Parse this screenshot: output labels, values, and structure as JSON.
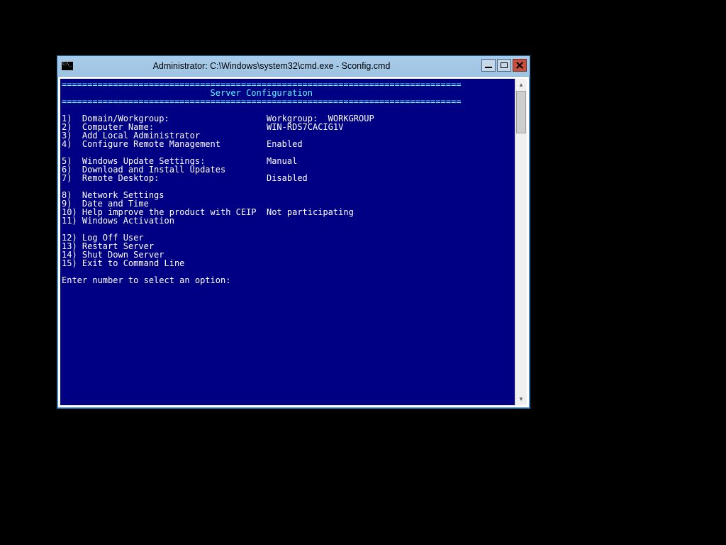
{
  "window": {
    "title": "Administrator: C:\\Windows\\system32\\cmd.exe - Sconfig.cmd"
  },
  "hr": "==============================================================================",
  "header_title": "                             Server Configuration",
  "blank": "",
  "menu": {
    "i1": {
      "num": "1)",
      "label": "Domain/Workgroup:",
      "value": "Workgroup:  WORKGROUP"
    },
    "i2": {
      "num": "2)",
      "label": "Computer Name:",
      "value": "WIN-RDS7CACIG1V"
    },
    "i3": {
      "num": "3)",
      "label": "Add Local Administrator",
      "value": ""
    },
    "i4": {
      "num": "4)",
      "label": "Configure Remote Management",
      "value": "Enabled"
    },
    "i5": {
      "num": "5)",
      "label": "Windows Update Settings:",
      "value": "Manual"
    },
    "i6": {
      "num": "6)",
      "label": "Download and Install Updates",
      "value": ""
    },
    "i7": {
      "num": "7)",
      "label": "Remote Desktop:",
      "value": "Disabled"
    },
    "i8": {
      "num": "8)",
      "label": "Network Settings",
      "value": ""
    },
    "i9": {
      "num": "9)",
      "label": "Date and Time",
      "value": ""
    },
    "i10": {
      "num": "10)",
      "label": "Help improve the product with CEIP",
      "value": "Not participating"
    },
    "i11": {
      "num": "11)",
      "label": "Windows Activation",
      "value": ""
    },
    "i12": {
      "num": "12)",
      "label": "Log Off User",
      "value": ""
    },
    "i13": {
      "num": "13)",
      "label": "Restart Server",
      "value": ""
    },
    "i14": {
      "num": "14)",
      "label": "Shut Down Server",
      "value": ""
    },
    "i15": {
      "num": "15)",
      "label": "Exit to Command Line",
      "value": ""
    }
  },
  "prompt": "Enter number to select an option: "
}
